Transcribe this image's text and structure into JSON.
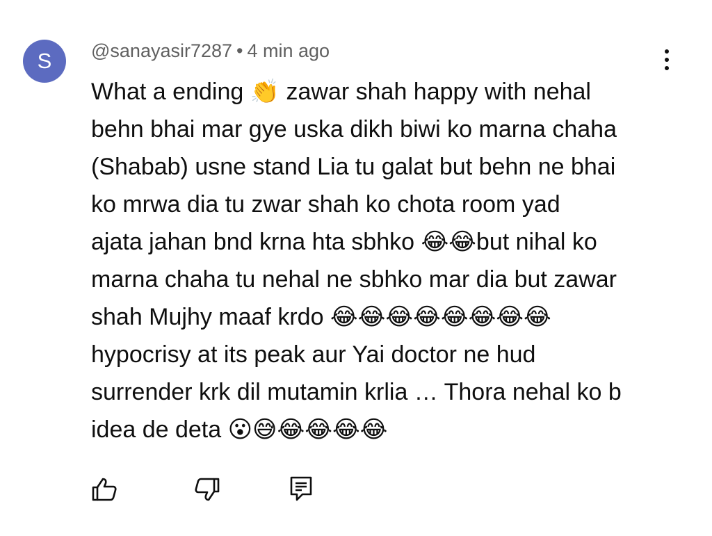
{
  "comment": {
    "avatar_letter": "S",
    "avatar_color": "#5c6bc0",
    "username": "@sanayasir7287",
    "separator": "•",
    "timestamp": "4 min ago",
    "lines": [
      {
        "text": "What a ending 👏 zawar shah happy with nehal"
      },
      {
        "text": "behn bhai mar gye uska dikh biwi ko marna chaha"
      },
      {
        "text": "(Shabab) usne stand Lia tu galat but behn ne bhai"
      },
      {
        "text": "ko mrwa dia tu zwar shah ko chota room yad"
      },
      {
        "text": "ajata jahan bnd krna hta sbhko 😂😂but nihal ko"
      },
      {
        "text": "marna chaha tu nehal ne sbhko mar dia but zawar"
      },
      {
        "text": "shah Mujhy maaf krdo 😂😂😂😂😂😂😂😂"
      },
      {
        "text": "hypocrisy at its peak aur Yai doctor ne hud"
      },
      {
        "text": "surrender krk dil mutamin krlia … Thora nehal ko b"
      },
      {
        "text": "idea de deta 😮😅😂😂😂😂"
      }
    ]
  },
  "actions": {
    "like_icon": "thumbs-up-icon",
    "dislike_icon": "thumbs-down-icon",
    "reply_icon": "reply-comment-icon"
  }
}
